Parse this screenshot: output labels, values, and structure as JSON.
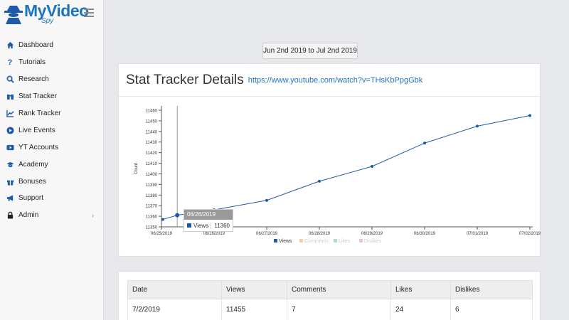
{
  "app": {
    "logo_text": "MyVideo",
    "logo_sub": "Spy"
  },
  "sidebar": {
    "items": [
      {
        "label": "Dashboard",
        "icon": "home-icon"
      },
      {
        "label": "Tutorials",
        "icon": "question-icon"
      },
      {
        "label": "Research",
        "icon": "search-icon"
      },
      {
        "label": "Stat Tracker",
        "icon": "binoculars-icon"
      },
      {
        "label": "Rank Tracker",
        "icon": "line-chart-icon"
      },
      {
        "label": "Live Events",
        "icon": "play-circle-icon"
      },
      {
        "label": "YT Accounts",
        "icon": "youtube-icon"
      },
      {
        "label": "Academy",
        "icon": "graduation-cap-icon"
      },
      {
        "label": "Bonuses",
        "icon": "gift-icon"
      },
      {
        "label": "Support",
        "icon": "megaphone-icon"
      },
      {
        "label": "Admin",
        "icon": "lock-icon"
      }
    ],
    "admin_chevron": "›"
  },
  "date_range": "Jun 2nd 2019 to Jul 2nd 2019",
  "stat_card": {
    "title": "Stat Tracker Details",
    "url": "https://www.youtube.com/watch?v=THsKbPpgGbk"
  },
  "tooltip": {
    "date": "06/26/2019",
    "series": "Views",
    "value": "11360"
  },
  "chart_data": {
    "type": "line",
    "ylabel": "Count",
    "ylim": [
      11350,
      11460
    ],
    "y_ticks": [
      11350,
      11360,
      11370,
      11380,
      11390,
      11400,
      11410,
      11420,
      11430,
      11440,
      11450,
      11460
    ],
    "x_tick_labels": [
      "06/25/2019",
      "06/26/2019",
      "06/27/2019",
      "06/28/2019",
      "06/29/2019",
      "06/30/2019",
      "07/01/2019",
      "07/02/2019"
    ],
    "x": [
      "06/25/2019",
      "06/26/2019",
      "06/27/2019",
      "06/28/2019",
      "06/29/2019",
      "06/30/2019",
      "07/01/2019",
      "07/02/2019"
    ],
    "series": [
      {
        "name": "Views",
        "color": "#1e5aa8",
        "values": [
          11357,
          11361,
          11366,
          11375,
          11393,
          11407,
          11429,
          11445,
          11455
        ]
      },
      {
        "name": "Comments",
        "color": "#f5cfa8",
        "values": []
      },
      {
        "name": "Likes",
        "color": "#bcd5dd",
        "values": []
      },
      {
        "name": "Dislikes",
        "color": "#f3c4c4",
        "values": []
      }
    ],
    "point_dates": [
      "06/25/2019",
      "06/25/2019",
      "06/26/2019",
      "06/27/2019",
      "06/28/2019",
      "06/29/2019",
      "06/30/2019",
      "07/01/2019",
      "07/02/2019"
    ],
    "legend_position": "bottom"
  },
  "table": {
    "headers": [
      "Date",
      "Views",
      "Comments",
      "Likes",
      "Dislikes"
    ],
    "rows": [
      [
        "7/2/2019",
        "11455",
        "7",
        "24",
        "6"
      ]
    ]
  }
}
